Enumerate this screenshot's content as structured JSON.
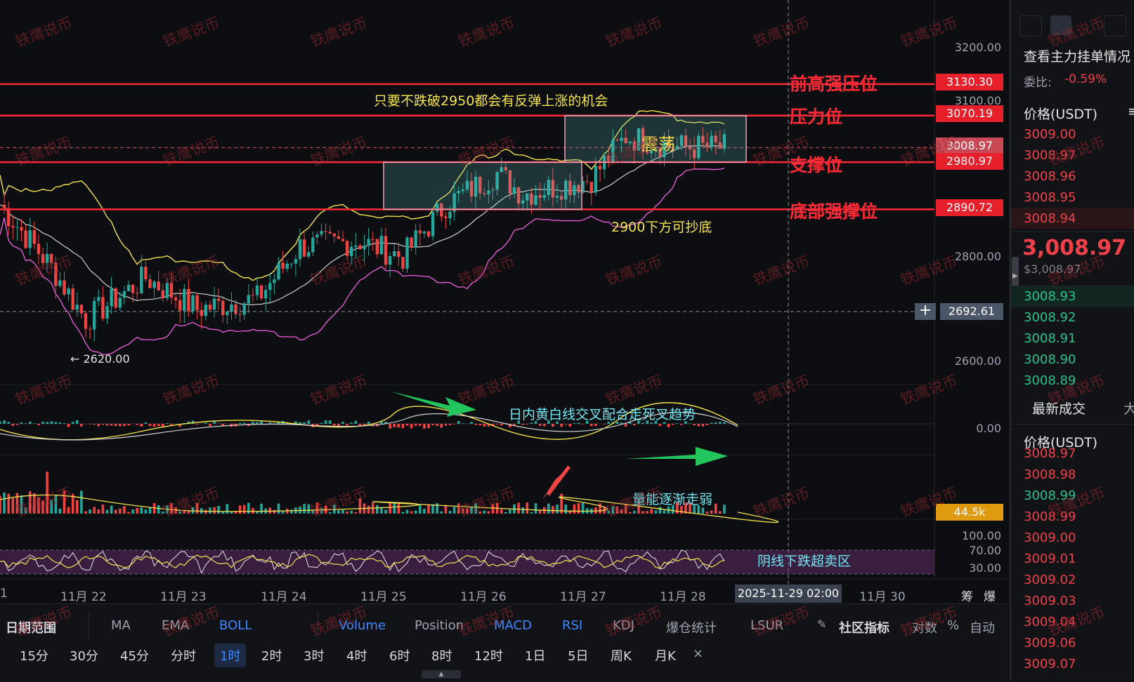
{
  "colors": {
    "up": "#26a69a",
    "down": "#ef4444",
    "level": "#ff2a35",
    "yellow_line": "#f2e34d",
    "mid_line": "#d0d0d0",
    "lower_band": "#e05ad0",
    "accent": "#3d87ff"
  },
  "price_axis": [
    "3200.00",
    "3100.00",
    "2800.00",
    "2600.00"
  ],
  "level_tags": {
    "high": "3130.30",
    "pressure": "3070.19",
    "current": "3008.97",
    "support": "2980.97",
    "bottom": "2890.72",
    "crosshair": "2692.61"
  },
  "level_labels": {
    "high": "前高强压位",
    "pressure": "压力位",
    "support": "支撑位",
    "bottom": "底部强撑位"
  },
  "annotations": {
    "rebound": "只要不跌破2950都会有反弹上涨的机会",
    "range": "震荡",
    "buy_dip": "2900下方可抄底",
    "low_marker": "← 2620.00",
    "macd": "日内黄白线交叉配合走死叉趋势",
    "volume": "量能逐渐走弱",
    "rsi": "阴线下跌超卖区"
  },
  "macd_axis": "0.00",
  "volume_tag": "44.5k",
  "rsi_axis": [
    "100.00",
    "70.00",
    "30.00"
  ],
  "date_axis": [
    "1",
    "11月 22",
    "11月 23",
    "11月 24",
    "11月 25",
    "11月 26",
    "11月 27",
    "11月 28",
    "11月 30"
  ],
  "crosshair_date": "2025-11-29 02:00",
  "axis_buttons": [
    "筹",
    "爆"
  ],
  "indicator_bar": {
    "range_label": "日期范围",
    "items": [
      "MA",
      "EMA",
      "BOLL",
      "Volume",
      "Position",
      "MACD",
      "RSI",
      "KDJ",
      "爆仓统计",
      "LSUR"
    ],
    "active": [
      "BOLL",
      "Volume",
      "MACD",
      "RSI"
    ],
    "community": "社区指标",
    "log": "对数",
    "pct": "%",
    "auto": "自动"
  },
  "timeframes": [
    "15分",
    "30分",
    "45分",
    "分时",
    "1时",
    "2时",
    "3时",
    "4时",
    "6时",
    "8时",
    "12时",
    "1日",
    "5日",
    "周K",
    "月K"
  ],
  "active_timeframe": "1时",
  "orderbook": {
    "title": "查看主力挂单情况",
    "ratio_label": "委比:",
    "ratio_value": "-0.59%",
    "price_header": "价格(USDT)",
    "asks": [
      "3009.00",
      "3008.97",
      "3008.96",
      "3008.95",
      "3008.94"
    ],
    "last_price": "3,008.97",
    "last_usd": "$3,008.97",
    "bids": [
      "3008.93",
      "3008.92",
      "3008.91",
      "3008.90",
      "3008.89"
    ]
  },
  "trades": {
    "title": "最新成交",
    "col2": "大",
    "price_header": "价格(USDT)",
    "rows": [
      {
        "p": "3008.97",
        "s": "down"
      },
      {
        "p": "3008.98",
        "s": "down"
      },
      {
        "p": "3008.99",
        "s": "up"
      },
      {
        "p": "3008.99",
        "s": "down"
      },
      {
        "p": "3009.00",
        "s": "down"
      },
      {
        "p": "3009.01",
        "s": "down"
      },
      {
        "p": "3009.02",
        "s": "down"
      },
      {
        "p": "3009.03",
        "s": "down"
      },
      {
        "p": "3009.04",
        "s": "down"
      },
      {
        "p": "3009.06",
        "s": "down"
      },
      {
        "p": "3009.07",
        "s": "down"
      }
    ]
  },
  "watermark": "铁鹰说币"
}
